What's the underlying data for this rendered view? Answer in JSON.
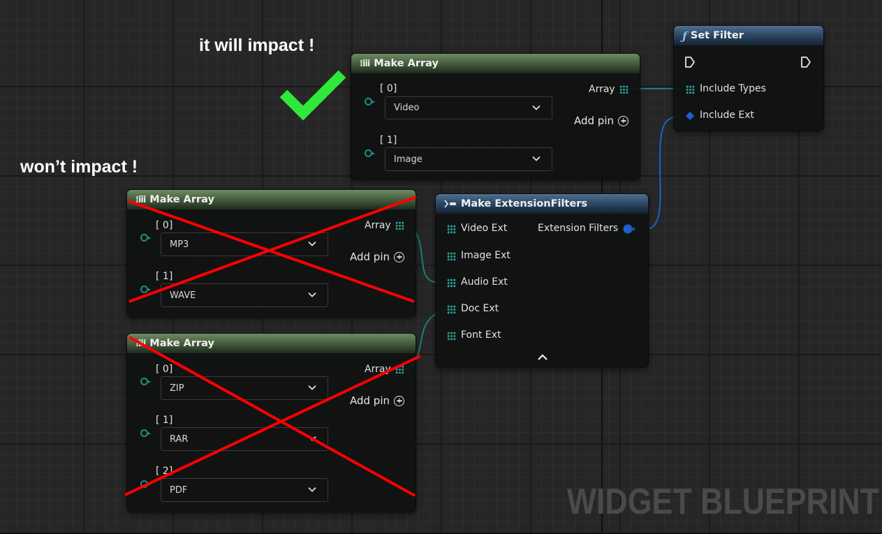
{
  "annotations": {
    "positive": "it will impact !",
    "negative": "won’t impact !"
  },
  "watermark": "WIDGET BLUEPRINT",
  "set_filter": {
    "title": "Set Filter",
    "pins": [
      "Include Types",
      "Include Ext"
    ]
  },
  "make_array_top": {
    "title": "Make Array",
    "output_label": "Array",
    "add_pin_label": "Add pin",
    "items": [
      {
        "index": "[ 0]",
        "value": "Video"
      },
      {
        "index": "[ 1]",
        "value": "Image"
      }
    ]
  },
  "make_array_mid": {
    "title": "Make Array",
    "output_label": "Array",
    "add_pin_label": "Add pin",
    "items": [
      {
        "index": "[ 0]",
        "value": "MP3"
      },
      {
        "index": "[ 1]",
        "value": "WAVE"
      }
    ]
  },
  "make_array_bottom": {
    "title": "Make Array",
    "output_label": "Array",
    "add_pin_label": "Add pin",
    "items": [
      {
        "index": "[ 0]",
        "value": "ZIP"
      },
      {
        "index": "[ 1]",
        "value": "RAR"
      },
      {
        "index": "[ 2]",
        "value": "PDF"
      }
    ]
  },
  "make_extension_filters": {
    "title": "Make ExtensionFilters",
    "inputs": [
      "Video Ext",
      "Image Ext",
      "Audio Ext",
      "Doc Ext",
      "Font Ext"
    ],
    "output_label": "Extension Filters"
  },
  "colors": {
    "array_pin": "#2aa79c",
    "struct_pin": "#1f5fcf",
    "wire_teal": "#1b7f79",
    "wire_blue": "#1f5fcf",
    "cross_red": "#ff0000",
    "check_green": "#2fe83a"
  }
}
